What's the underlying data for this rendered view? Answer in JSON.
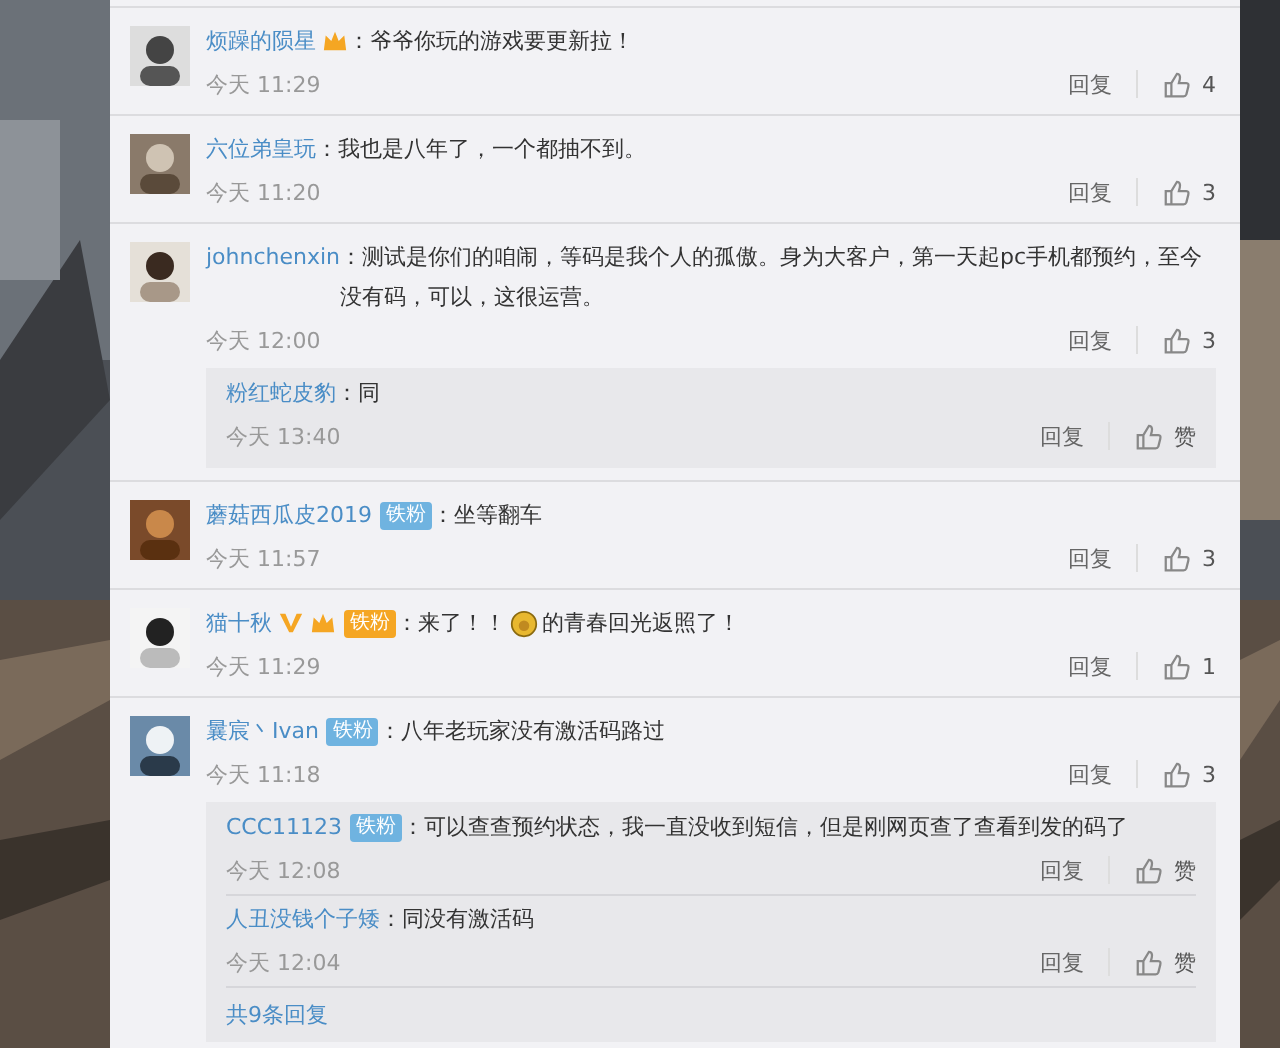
{
  "comments": [
    {
      "name": "烦躁的陨星",
      "badges": [
        {
          "kind": "vip"
        }
      ],
      "parts": [
        {
          "kind": "text",
          "text": "：爷爷你玩的游戏要更新拉！"
        }
      ],
      "time": "今天 11:29",
      "reply": "回复",
      "likes": "4"
    },
    {
      "name": "六位弟皇玩",
      "parts": [
        {
          "kind": "text",
          "text": "：我也是八年了，一个都抽不到。"
        }
      ],
      "time": "今天 11:20",
      "reply": "回复",
      "likes": "3"
    },
    {
      "name": "johnchenxin",
      "parts": [
        {
          "kind": "text",
          "text": "：测试是你们的咱闹，等码是我个人的孤傲。身为大客户，第一天起pc手机都预约，至今没有码，可以，这很运营。"
        }
      ],
      "time": "今天 12:00",
      "reply": "回复",
      "likes": "3",
      "replies": [
        {
          "name": "粉红蛇皮豹",
          "text": "：同",
          "time": "今天 13:40",
          "reply": "回复",
          "like": "赞"
        }
      ]
    },
    {
      "name": "蘑菇西瓜皮2019",
      "badges": [
        {
          "kind": "fan",
          "label": "铁粉",
          "color": "#6fb3e0"
        }
      ],
      "parts": [
        {
          "kind": "text",
          "text": "：坐等翻车"
        }
      ],
      "time": "今天 11:57",
      "reply": "回复",
      "likes": "3"
    },
    {
      "name": "猫十秋",
      "badges": [
        {
          "kind": "verified"
        },
        {
          "kind": "vip"
        },
        {
          "kind": "fan",
          "label": "铁粉",
          "color": "#f5a623"
        }
      ],
      "parts": [
        {
          "kind": "text",
          "text": "：来了！！"
        },
        {
          "kind": "emoji"
        },
        {
          "kind": "text",
          "text": "的青春回光返照了！"
        }
      ],
      "time": "今天 11:29",
      "reply": "回复",
      "likes": "1"
    },
    {
      "name": "曩宸丶Ivan",
      "badges": [
        {
          "kind": "fan",
          "label": "铁粉",
          "color": "#6fb3e0"
        }
      ],
      "parts": [
        {
          "kind": "text",
          "text": "：八年老玩家没有激活码路过"
        }
      ],
      "time": "今天 11:18",
      "reply": "回复",
      "likes": "3",
      "replies": [
        {
          "name": "CCC11123",
          "badges": [
            {
              "kind": "fan",
              "label": "铁粉",
              "color": "#6fb3e0"
            }
          ],
          "text": "：可以查查预约状态，我一直没收到短信，但是刚网页查了查看到发的码了",
          "time": "今天 12:08",
          "reply": "回复",
          "like": "赞"
        },
        {
          "name": "人丑没钱个子矮",
          "text": "：同没有激活码",
          "time": "今天 12:04",
          "reply": "回复",
          "like": "赞"
        }
      ],
      "more": "共9条回复"
    }
  ]
}
